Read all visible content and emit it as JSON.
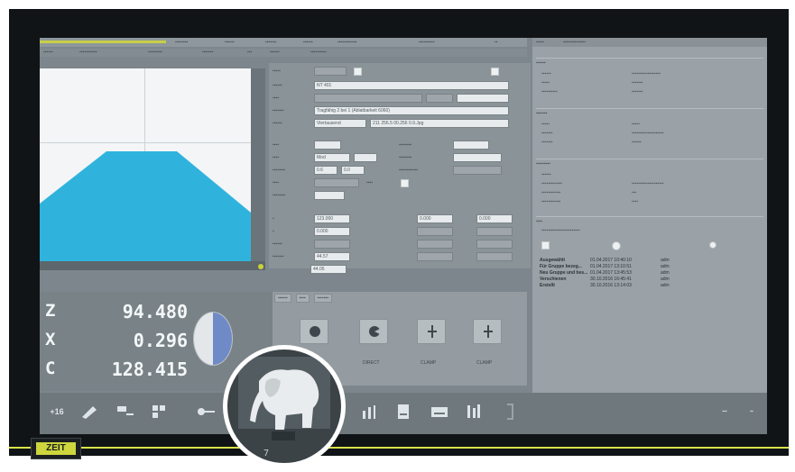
{
  "brand": {
    "logo_text": "ZEIT"
  },
  "menu": {
    "items": [
      "",
      "",
      "",
      "",
      "",
      "",
      ""
    ]
  },
  "form": {
    "rows": [
      {
        "label": "",
        "value": "",
        "checked": true
      },
      {
        "label": "",
        "value": "NT 401"
      },
      {
        "label": "",
        "value": ""
      },
      {
        "label": "",
        "value": "Tragfähig 2 bei 1 (Ablatbarkeit 6060)"
      },
      {
        "label": "",
        "value": "Viertausend",
        "value2": "211 256.5 00.256 0.9.Jpg"
      },
      {
        "label": "",
        "value": ""
      },
      {
        "label": "",
        "value": "Mod"
      },
      {
        "label": "",
        "value": "0.6",
        "value2": "0.0"
      },
      {
        "label": "",
        "value": ""
      },
      {
        "label": "",
        "value": ""
      }
    ],
    "grid": [
      [
        "123.000",
        "",
        "0.000",
        "",
        "0.000"
      ],
      [
        "0.000",
        "",
        "",
        "",
        ""
      ],
      [
        "",
        "",
        "",
        "",
        ""
      ],
      [
        "44.57",
        "",
        "",
        "",
        ""
      ],
      [
        "44.05",
        "",
        "",
        "",
        ""
      ]
    ]
  },
  "dro": {
    "axes": [
      {
        "label": "Z",
        "value": "94.480"
      },
      {
        "label": "X",
        "value": "0.296"
      },
      {
        "label": "C",
        "value": "128.415"
      }
    ]
  },
  "tools": {
    "tabs": [
      "",
      "",
      ""
    ],
    "items": [
      {
        "label": "",
        "icon": "circle-target-icon"
      },
      {
        "label": "DIRECT",
        "icon": "pie-target-icon"
      },
      {
        "label": "CLAMP",
        "icon": "clamp-icon"
      },
      {
        "label": "CLAMP",
        "icon": "clamp-icon"
      }
    ]
  },
  "right": {
    "tabs": [
      "",
      ""
    ],
    "sections": [
      "",
      "",
      "",
      ""
    ],
    "table": [
      {
        "name": "Ausgewählt",
        "date": "01.04.2017 10:40:10",
        "user": "adm"
      },
      {
        "name": "Für Gruppe bezeg...",
        "date": "01.04.2017 13:10:51",
        "user": "adm"
      },
      {
        "name": "Neu Gruppe und bes...",
        "date": "01.04.2017 13:45:53",
        "user": "adm"
      },
      {
        "name": "Verschienen",
        "date": "30.10.2016 16:45:41",
        "user": "adm"
      },
      {
        "name": "Erstellt",
        "date": "30.10.2016 13:14:03",
        "user": "adm"
      }
    ]
  },
  "bottom": {
    "buttons": [
      "+16",
      "",
      "",
      "",
      "",
      "",
      "",
      "",
      "",
      ""
    ]
  },
  "colors": {
    "part_fill": "#2fb3dd",
    "accent": "#cdd63d",
    "pie_blue": "#6f8ac7"
  }
}
